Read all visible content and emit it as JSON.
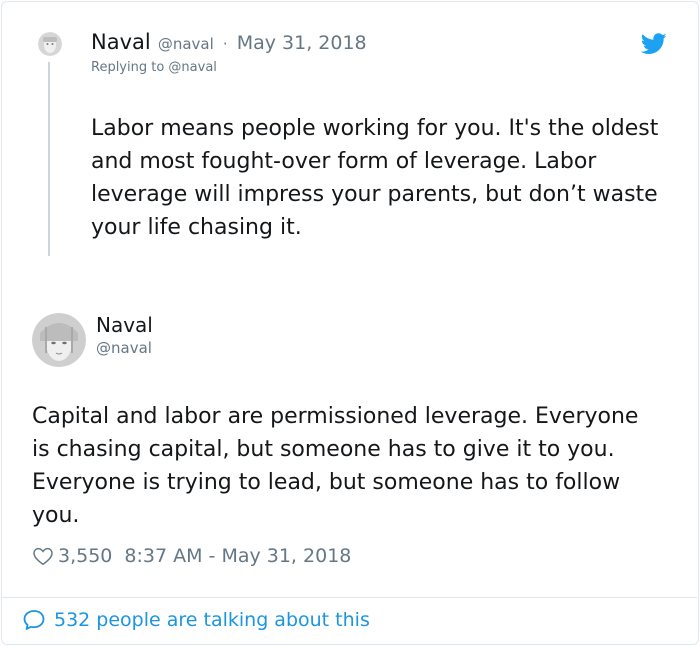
{
  "reply_tweet": {
    "author_name": "Naval",
    "author_handle": "@naval",
    "separator": "·",
    "date": "May 31, 2018",
    "replying_to": "Replying to @naval",
    "text": "Labor means people working for you. It's the oldest and most fought-over form of leverage. Labor leverage will impress your parents, but don’t waste your life chasing it."
  },
  "main_tweet": {
    "author_name": "Naval",
    "author_handle": "@naval",
    "text": "Capital and labor are permissioned leverage. Everyone is chasing capital, but someone has to give it to you. Everyone is trying to lead, but someone has to follow you.",
    "likes": "3,550",
    "timestamp": "8:37 AM - May 31, 2018"
  },
  "footer": {
    "talking": "532 people are talking about this"
  },
  "icons": {
    "brand": "twitter-bird-icon",
    "like": "heart-icon",
    "reply": "speech-bubble-icon"
  },
  "colors": {
    "brand_blue": "#1da1f2",
    "link_blue": "#1b95e0",
    "secondary_text": "#657786",
    "primary_text": "#14171a",
    "border": "#e1e8ed"
  }
}
